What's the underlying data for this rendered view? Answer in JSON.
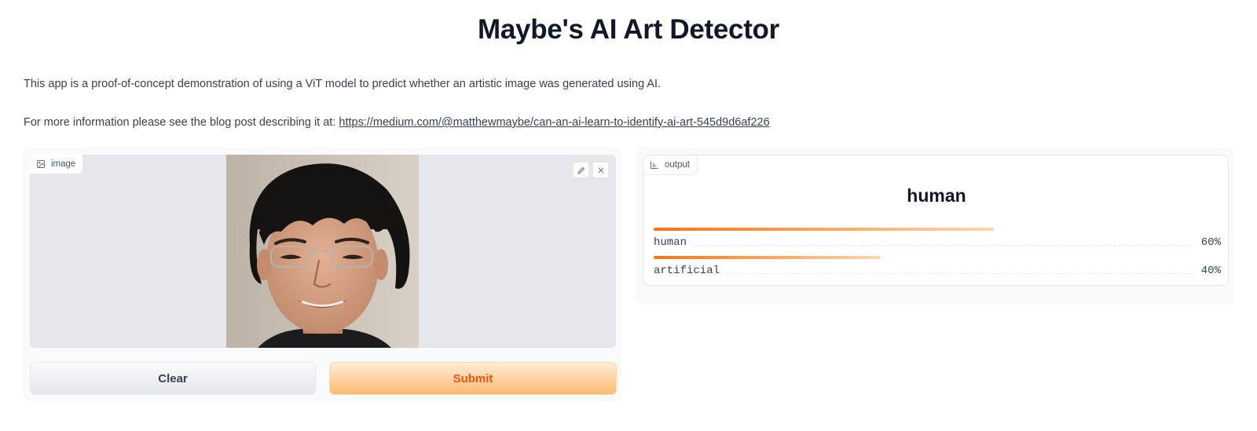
{
  "app": {
    "title": "Maybe's AI Art Detector",
    "description_1": "This app is a proof-of-concept demonstration of using a ViT model to predict whether an artistic image was generated using AI.",
    "description_2_prefix": "For more information please see the blog post describing it at: ",
    "description_2_link": "https://medium.com/@matthewmaybe/can-an-ai-learn-to-identify-ai-art-545d9d6af226"
  },
  "input": {
    "label": "image",
    "icon": "image-icon",
    "tools": [
      "edit-icon",
      "close-icon"
    ]
  },
  "buttons": {
    "clear": "Clear",
    "submit": "Submit"
  },
  "output": {
    "label": "output",
    "icon": "bar-chart-icon",
    "predicted": "human",
    "confidences": [
      {
        "label": "human",
        "value": 0.6,
        "display": "60%"
      },
      {
        "label": "artificial",
        "value": 0.4,
        "display": "40%"
      }
    ]
  },
  "colors": {
    "accent": "#f97316",
    "submit_text": "#ea580c"
  }
}
